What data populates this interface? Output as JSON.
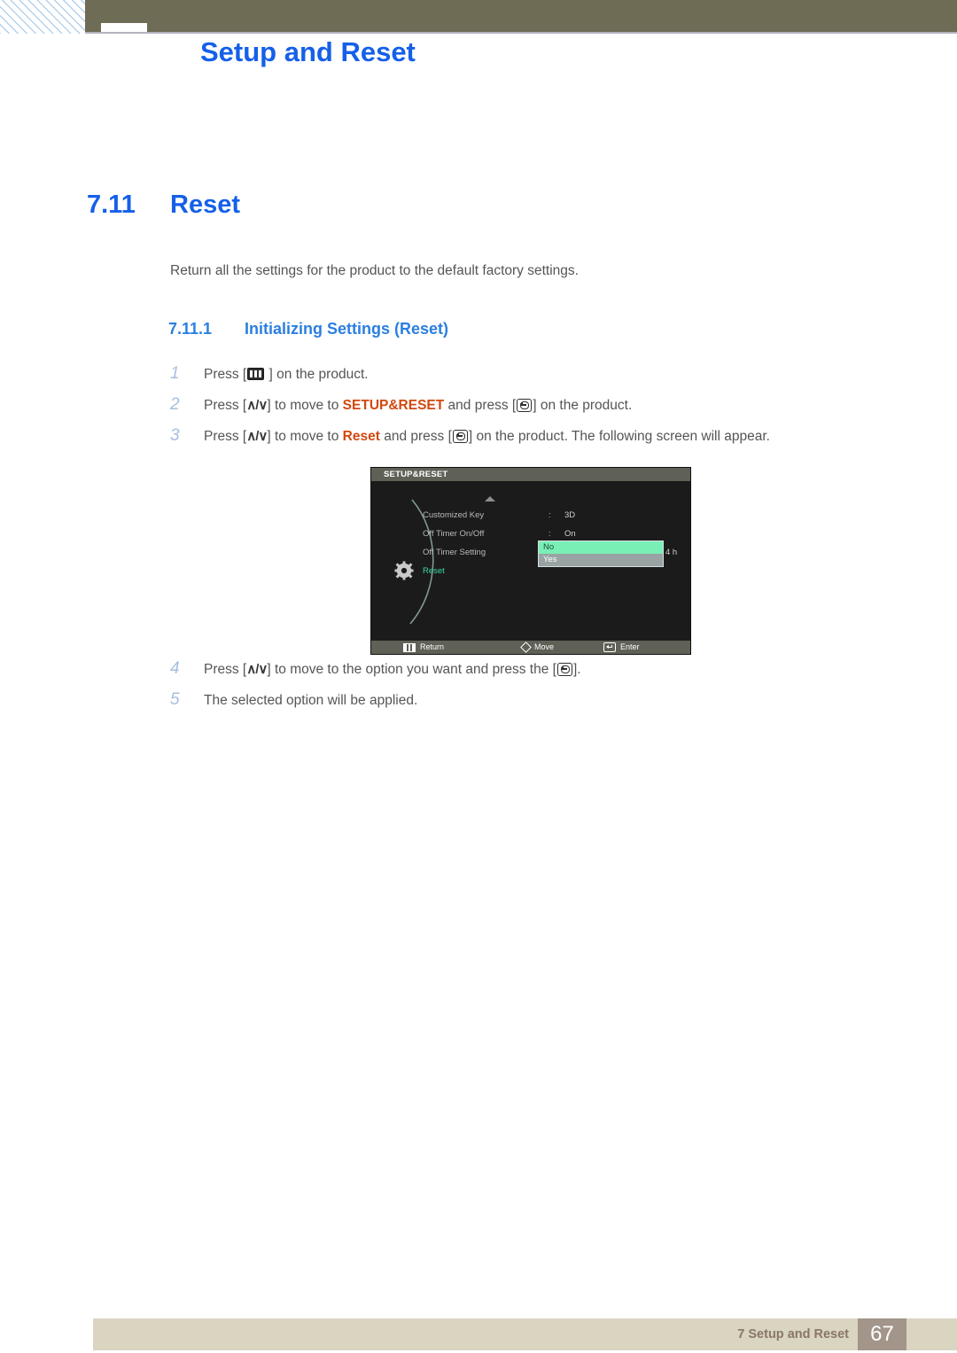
{
  "header": {
    "title": "Setup and Reset"
  },
  "section": {
    "number": "7.11",
    "title": "Reset",
    "intro": "Return all the settings for the product to the default factory settings."
  },
  "subsection": {
    "number": "7.11.1",
    "title": "Initializing Settings (Reset)"
  },
  "steps_upper": [
    {
      "num": "1",
      "parts": [
        {
          "type": "text",
          "value": "Press ["
        },
        {
          "type": "icon",
          "value": "menu-icon"
        },
        {
          "type": "text",
          "value": " ] on the product."
        }
      ]
    },
    {
      "num": "2",
      "parts": [
        {
          "type": "text",
          "value": "Press ["
        },
        {
          "type": "icon",
          "value": "up-down-icon"
        },
        {
          "type": "text",
          "value": "] to move to "
        },
        {
          "type": "keyword",
          "value": "SETUP&RESET"
        },
        {
          "type": "text",
          "value": " and press ["
        },
        {
          "type": "icon",
          "value": "enter-icon"
        },
        {
          "type": "text",
          "value": "] on the product."
        }
      ]
    },
    {
      "num": "3",
      "parts": [
        {
          "type": "text",
          "value": "Press ["
        },
        {
          "type": "icon",
          "value": "up-down-icon"
        },
        {
          "type": "text",
          "value": "] to move to "
        },
        {
          "type": "keyword",
          "value": "Reset"
        },
        {
          "type": "text",
          "value": " and press ["
        },
        {
          "type": "icon",
          "value": "enter-icon"
        },
        {
          "type": "text",
          "value": "] on the product. The following screen will appear."
        }
      ]
    }
  ],
  "steps_lower": [
    {
      "num": "4",
      "parts": [
        {
          "type": "text",
          "value": "Press ["
        },
        {
          "type": "icon",
          "value": "up-down-icon"
        },
        {
          "type": "text",
          "value": "] to move to the option you want and press the ["
        },
        {
          "type": "icon",
          "value": "enter-icon"
        },
        {
          "type": "text",
          "value": "]."
        }
      ]
    },
    {
      "num": "5",
      "parts": [
        {
          "type": "text",
          "value": "The selected option will be applied."
        }
      ]
    }
  ],
  "osd": {
    "title": "SETUP&RESET",
    "rows": [
      {
        "label": "Customized Key",
        "colon": ":",
        "value": "3D",
        "active": false,
        "kind": "value"
      },
      {
        "label": "Off Timer On/Off",
        "colon": ":",
        "value": "On",
        "active": false,
        "kind": "value"
      },
      {
        "label": "Off Timer Setting",
        "colon": ":",
        "value": "4 h",
        "active": false,
        "kind": "slider",
        "slider_percent": 20
      },
      {
        "label": "Reset",
        "colon": "",
        "value": "",
        "active": true,
        "kind": "dropdown"
      }
    ],
    "dropdown": {
      "options": [
        {
          "label": "No",
          "selected": true
        },
        {
          "label": "Yes",
          "selected": false
        }
      ]
    },
    "footer": [
      {
        "icon": "menu-icon",
        "label": "Return"
      },
      {
        "icon": "diamond-move-icon",
        "label": "Move"
      },
      {
        "icon": "enter-icon",
        "label": "Enter"
      }
    ]
  },
  "page_footer": {
    "chapter": "7 Setup and Reset",
    "page_number": "67"
  },
  "colors": {
    "accent_blue": "#1560e8",
    "sub_blue": "#2b7fe0",
    "keyword_orange": "#d2490f",
    "olive": "#6e6c55",
    "footer_bar": "#d9d5c1",
    "footer_page_box": "#a3958a",
    "osd_bg": "#1b1b1b",
    "osd_bar": "#5f6157",
    "osd_active_green": "#3fd8a0",
    "osd_selected_green": "#79efb6",
    "osd_dropdown_gray": "#9aa3a3"
  }
}
